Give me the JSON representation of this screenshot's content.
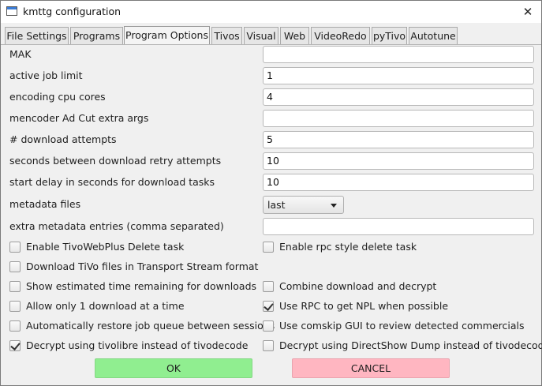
{
  "window": {
    "title": "kmttg configuration"
  },
  "tabs": [
    {
      "label": "File Settings"
    },
    {
      "label": "Programs"
    },
    {
      "label": "Program Options"
    },
    {
      "label": "Tivos"
    },
    {
      "label": "Visual"
    },
    {
      "label": "Web"
    },
    {
      "label": "VideoRedo"
    },
    {
      "label": "pyTivo"
    },
    {
      "label": "Autotune"
    }
  ],
  "active_tab": "Program Options",
  "fields": {
    "mak": {
      "label": "MAK",
      "value": ""
    },
    "active_job_limit": {
      "label": "active job limit",
      "value": "1"
    },
    "encoding_cpu_cores": {
      "label": "encoding cpu cores",
      "value": "4"
    },
    "mencoder_args": {
      "label": "mencoder Ad Cut extra args",
      "value": ""
    },
    "download_attempts": {
      "label": "# download attempts",
      "value": "5"
    },
    "retry_seconds": {
      "label": "seconds between download retry attempts",
      "value": "10"
    },
    "start_delay": {
      "label": "start delay in seconds for download tasks",
      "value": "10"
    },
    "metadata_files": {
      "label": "metadata files",
      "value": "last"
    },
    "extra_metadata": {
      "label": "extra metadata entries (comma separated)",
      "value": ""
    }
  },
  "checkboxes": {
    "tivowebplus_delete": {
      "label": "Enable TivoWebPlus Delete task",
      "checked": false
    },
    "rpc_delete": {
      "label": "Enable rpc style delete task",
      "checked": false
    },
    "transport_stream": {
      "label": "Download TiVo files in Transport Stream format",
      "checked": false
    },
    "estimated_time": {
      "label": "Show estimated time remaining for downloads",
      "checked": false
    },
    "combine_download": {
      "label": "Combine download and decrypt",
      "checked": false
    },
    "one_download": {
      "label": "Allow only 1 download at a time",
      "checked": false
    },
    "rpc_npl": {
      "label": "Use RPC to get NPL when possible",
      "checked": true
    },
    "restore_queue": {
      "label": "Automatically restore job queue between sessions",
      "checked": false
    },
    "comskip_gui": {
      "label": "Use comskip GUI to review detected commercials",
      "checked": false
    },
    "tivolibre": {
      "label": "Decrypt using tivolibre instead of tivodecode",
      "checked": true
    },
    "directshow": {
      "label": "Decrypt using DirectShow Dump instead of tivodecode",
      "checked": false
    }
  },
  "buttons": {
    "ok": "OK",
    "cancel": "CANCEL"
  },
  "colors": {
    "ok_button": "#90ee90",
    "cancel_button": "#ffb6c1"
  }
}
